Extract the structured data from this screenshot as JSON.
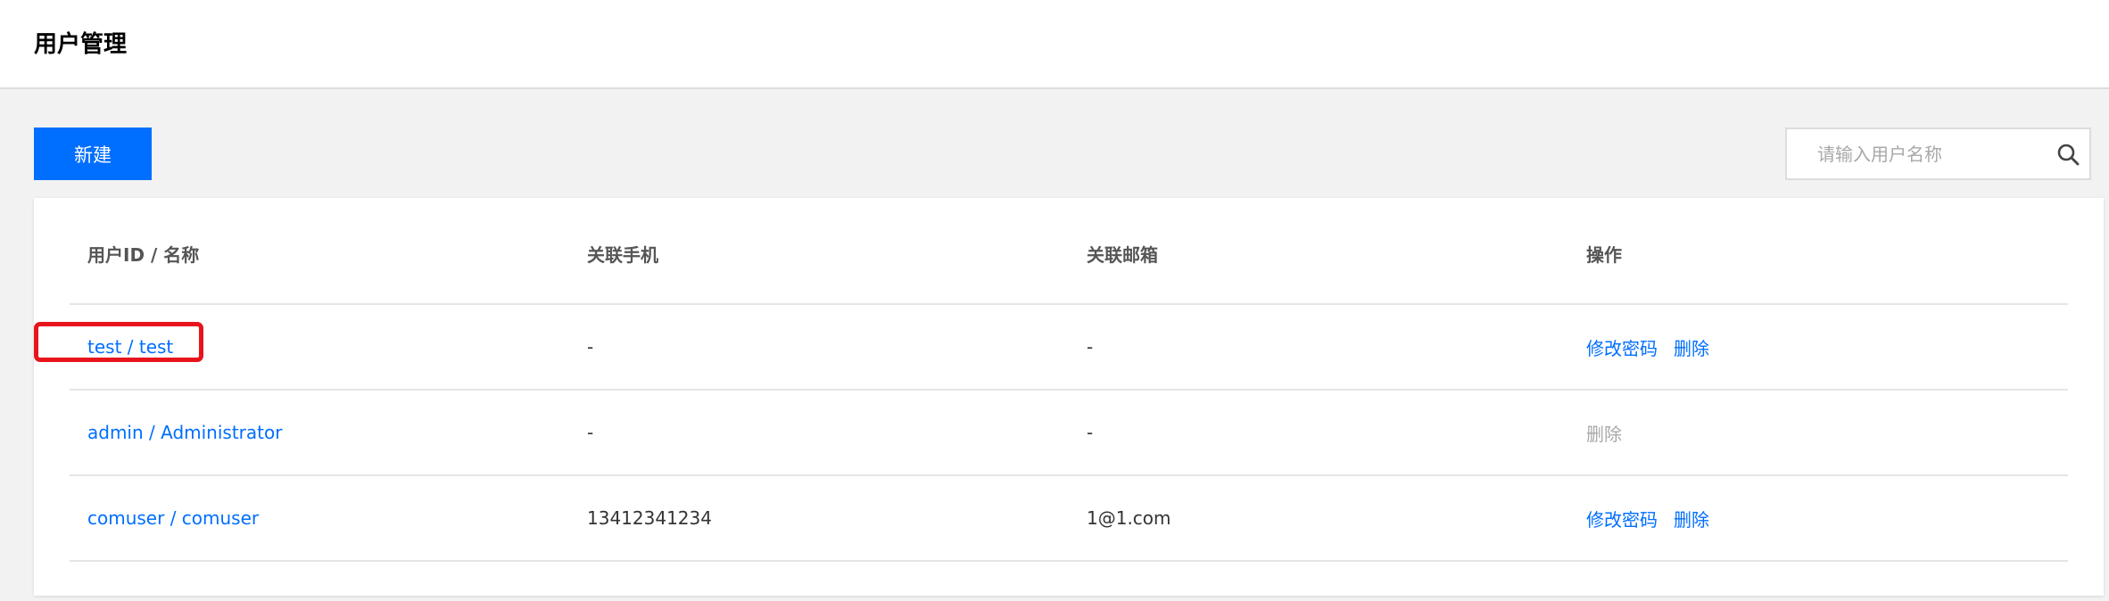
{
  "header": {
    "title": "用户管理"
  },
  "toolbar": {
    "new_label": "新建",
    "search_placeholder": "请输入用户名称",
    "search_value": ""
  },
  "table": {
    "columns": [
      "用户ID / 名称",
      "关联手机",
      "关联邮箱",
      "操作"
    ],
    "rows": [
      {
        "user": "test / test",
        "phone": "-",
        "email": "-",
        "actions": [
          "修改密码",
          "删除"
        ]
      },
      {
        "user": "admin / Administrator",
        "phone": "-",
        "email": "-",
        "actions": [
          "删除"
        ]
      },
      {
        "user": "comuser / comuser",
        "phone": "13412341234",
        "email": "1@1.com",
        "actions": [
          "修改密码",
          "删除"
        ]
      }
    ]
  },
  "colors": {
    "accent": "#006eff",
    "highlight": "#e8141c",
    "disabled": "#a8a8a8"
  },
  "icons": {
    "search": "search-icon"
  }
}
